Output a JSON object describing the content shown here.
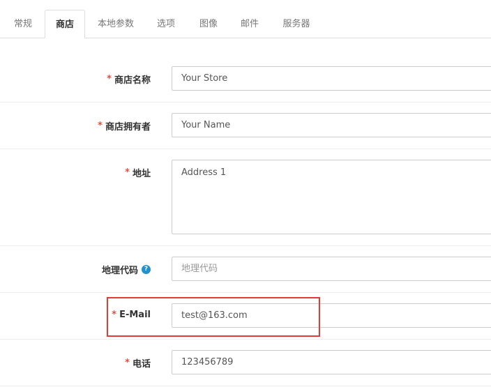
{
  "tabs": [
    {
      "label": "常规",
      "active": false
    },
    {
      "label": "商店",
      "active": true
    },
    {
      "label": "本地参数",
      "active": false
    },
    {
      "label": "选项",
      "active": false
    },
    {
      "label": "图像",
      "active": false
    },
    {
      "label": "邮件",
      "active": false
    },
    {
      "label": "服务器",
      "active": false
    }
  ],
  "form": {
    "store_name": {
      "label": "商店名称",
      "required": "*",
      "value": "Your Store"
    },
    "store_owner": {
      "label": "商店拥有者",
      "required": "*",
      "value": "Your Name"
    },
    "address": {
      "label": "地址",
      "required": "*",
      "value": "Address 1"
    },
    "geocode": {
      "label": "地理代码",
      "help_icon": "?",
      "placeholder": "地理代码",
      "value": ""
    },
    "email": {
      "label": "E-Mail",
      "required": "*",
      "value": "test@163.com"
    },
    "telephone": {
      "label": "电话",
      "required": "*",
      "value": "123456789"
    }
  },
  "colors": {
    "required_star": "#e3503e",
    "highlight_border": "#e53935",
    "help_icon": "#1e91cf"
  }
}
